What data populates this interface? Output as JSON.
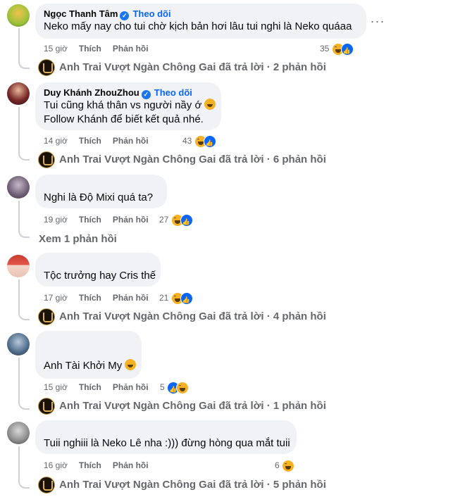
{
  "colors": {
    "bubble": "#f0f2f5",
    "meta": "#65676b",
    "link": "#0866ff",
    "like": "#0866ff",
    "haha": "#f7b125"
  },
  "labels": {
    "like": "Thích",
    "reply": "Phản hồi",
    "follow": "Theo dõi"
  },
  "page_name": "Anh Trai Vượt Ngàn Chông Gai",
  "comments": [
    {
      "author": "Ngọc Thanh Tâm",
      "verified": true,
      "lines": [
        "Neko mấy nay cho tui chờ kịch bản hơi lâu tui nghi là Neko quáaa"
      ],
      "time": "15 giờ",
      "reactions": "35",
      "reply_summary": "Anh Trai Vượt Ngàn Chông Gai đã trả lời · 2 phản hồi"
    },
    {
      "author": "Duy Khánh ZhouZhou",
      "verified": true,
      "lines": [
        "Tui cũng khá thân vs người nầy ớ",
        "Follow Khánh để biết kết quả nhé."
      ],
      "time": "14 giờ",
      "reactions": "43",
      "reply_summary": "Anh Trai Vượt Ngàn Chông Gai đã trả lời · 6 phản hồi"
    },
    {
      "author": "",
      "verified": false,
      "lines": [
        "Nghi là Độ Mixi quá ta?"
      ],
      "time": "19 giờ",
      "reactions": "27",
      "reply_summary": "Xem 1 phản hồi"
    },
    {
      "author": "",
      "verified": false,
      "lines": [
        "Tộc trưởng hay Cris thế"
      ],
      "time": "17 giờ",
      "reactions": "21",
      "reply_summary": "Anh Trai Vượt Ngàn Chông Gai đã trả lời · 4 phản hồi"
    },
    {
      "author": "",
      "verified": false,
      "lines": [
        "Anh Tài Khởi My"
      ],
      "time": "15 giờ",
      "reactions": "5",
      "reply_summary": "Anh Trai Vượt Ngàn Chông Gai đã trả lời · 1 phản hồi"
    },
    {
      "author": "",
      "verified": false,
      "lines": [
        "Tuii nghiii là Neko Lê nha :))) đừng hòng qua mắt tuii"
      ],
      "time": "16 giờ",
      "reactions": "6",
      "reply_summary": "Anh Trai Vượt Ngàn Chông Gai đã trả lời · 5 phản hồi"
    }
  ]
}
